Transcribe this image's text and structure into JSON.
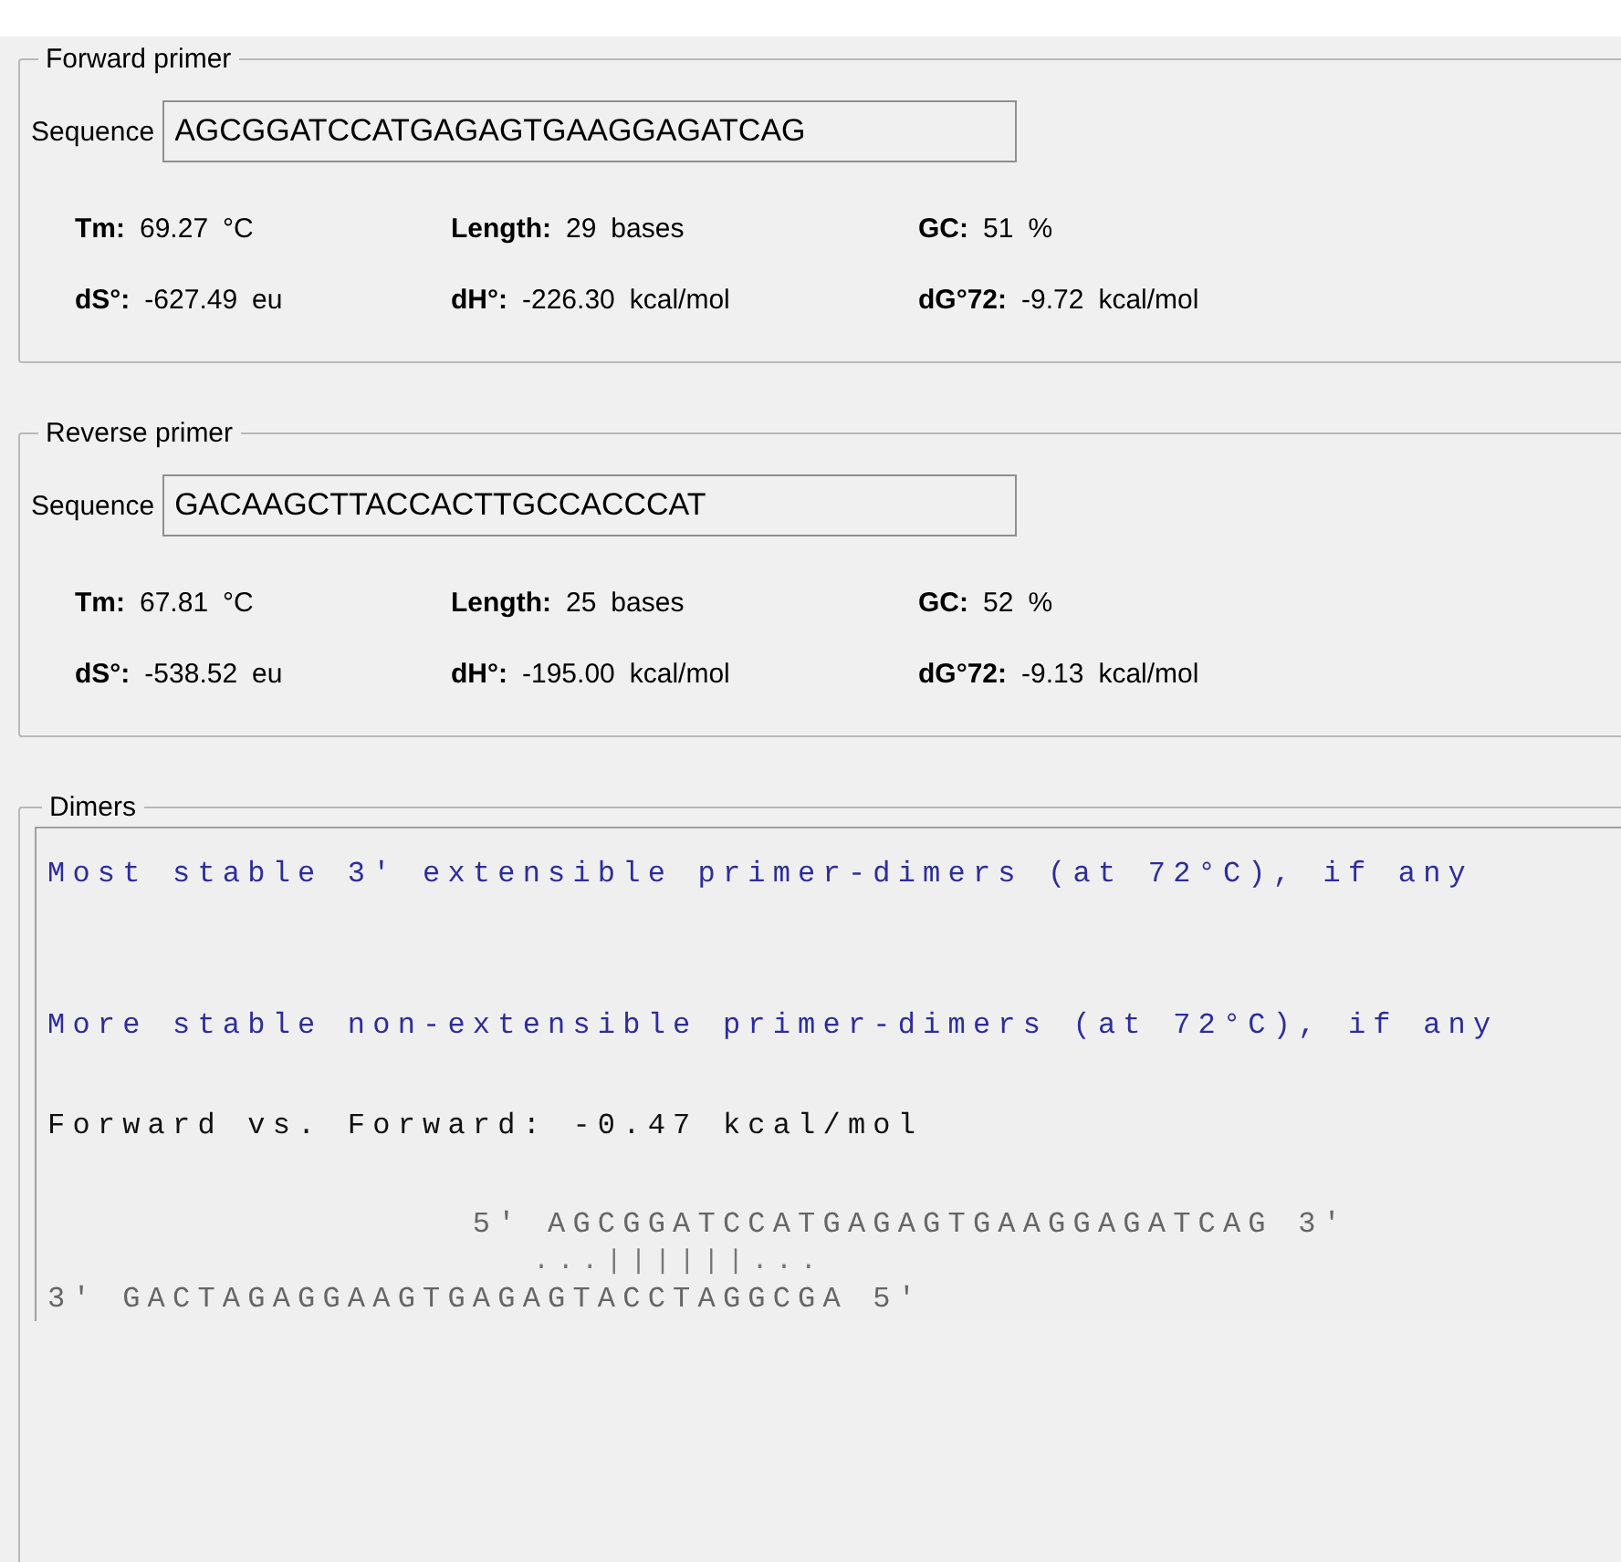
{
  "primers": [
    {
      "title": "Forward primer",
      "sequence_label": "Sequence",
      "sequence": "AGCGGATCCATGAGAGTGAAGGAGATCAG",
      "params": [
        {
          "label": "Tm:",
          "value": "69.27",
          "unit": "°C"
        },
        {
          "label": "Length:",
          "value": "29",
          "unit": "bases"
        },
        {
          "label": "GC:",
          "value": "51",
          "unit": "%"
        },
        {
          "label": "dS°:",
          "value": "-627.49",
          "unit": "eu"
        },
        {
          "label": "dH°:",
          "value": "-226.30",
          "unit": "kcal/mol"
        },
        {
          "label": "dG°72:",
          "value": "-9.72",
          "unit": "kcal/mol"
        }
      ]
    },
    {
      "title": "Reverse primer",
      "sequence_label": "Sequence",
      "sequence": "GACAAGCTTACCACTTGCCACCCAT",
      "params": [
        {
          "label": "Tm:",
          "value": "67.81",
          "unit": "°C"
        },
        {
          "label": "Length:",
          "value": "25",
          "unit": "bases"
        },
        {
          "label": "GC:",
          "value": "52",
          "unit": "%"
        },
        {
          "label": "dS°:",
          "value": "-538.52",
          "unit": "eu"
        },
        {
          "label": "dH°:",
          "value": "-195.00",
          "unit": "kcal/mol"
        },
        {
          "label": "dG°72:",
          "value": "-9.13",
          "unit": "kcal/mol"
        }
      ]
    }
  ],
  "dimers": {
    "title": "Dimers",
    "sections": [
      {
        "heading": "Most stable 3' extensible primer-dimers (at 72°C), if any"
      },
      {
        "heading": "More stable non-extensible primer-dimers (at 72°C), if any",
        "results": [
          {
            "title": "Forward vs. Forward: -0.47 kcal/mol",
            "top": "                 5' AGCGGATCCATGAGAGTGAAGGAGATCAG 3'",
            "match": "                    ...||||||...",
            "bottom": "3' GACTAGAGGAAGTGAGAGTACCTAGGCGA 5'"
          }
        ]
      }
    ]
  }
}
